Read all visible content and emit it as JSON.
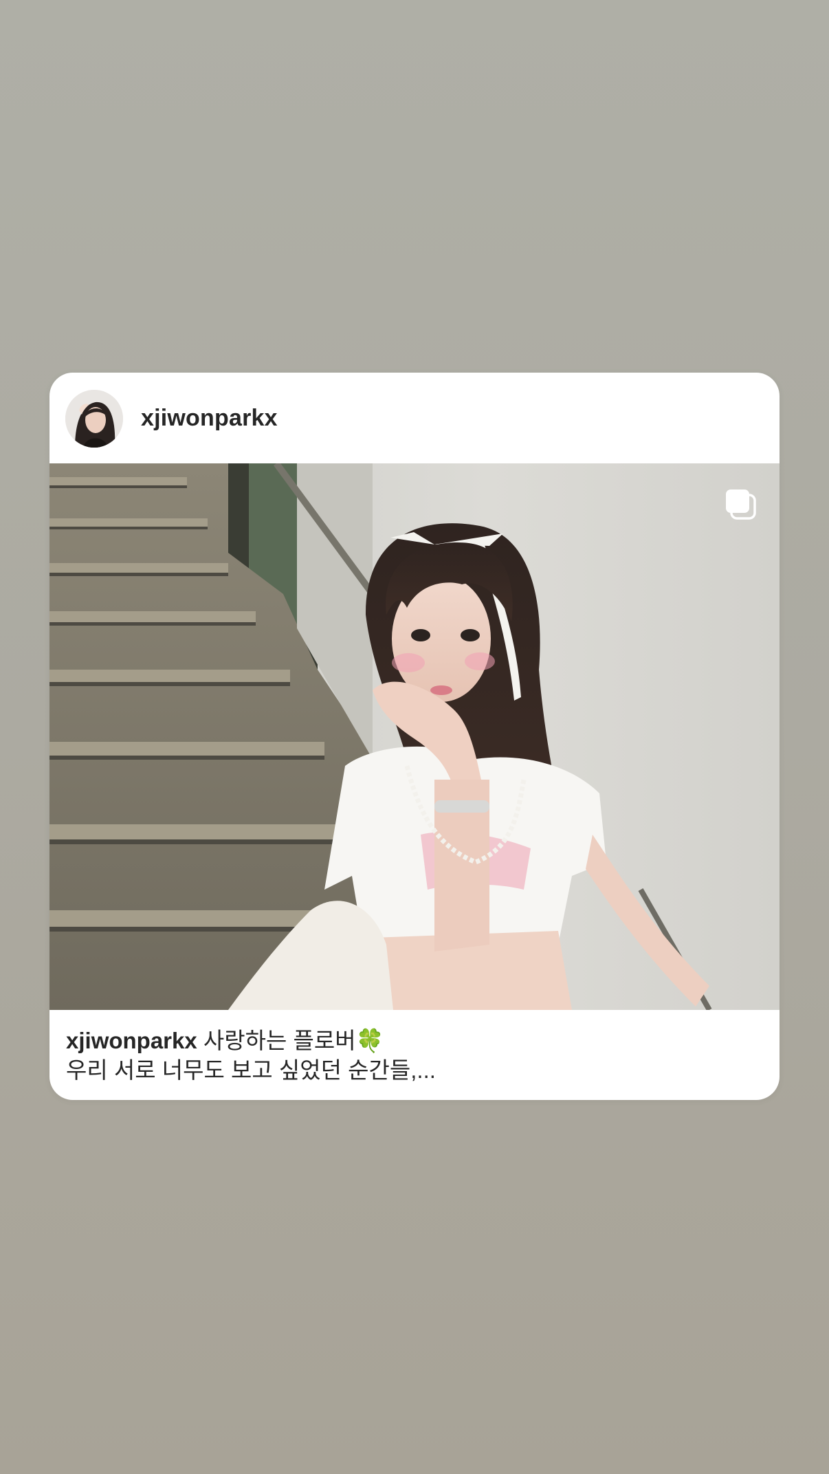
{
  "post": {
    "username": "xjiwonparkx",
    "caption_user": "xjiwonparkx",
    "caption_line1": "사랑하는 플로버",
    "caption_emoji": "🍀",
    "caption_line2": "우리 서로 너무도 보고 싶었던 순간들,...",
    "carousel_icon": "multiple-photos-icon",
    "avatar_icon": "profile-avatar",
    "photo_subject": "post-photo"
  },
  "colors": {
    "background_top": "#afafa6",
    "background_bottom": "#a8a397",
    "card": "#ffffff",
    "text": "#262626"
  }
}
